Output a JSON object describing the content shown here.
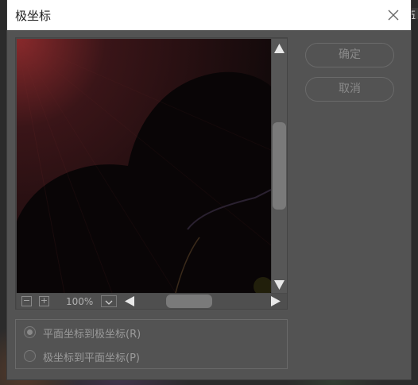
{
  "dialog": {
    "title": "极坐标"
  },
  "buttons": {
    "ok_label": "确定",
    "cancel_label": "取消"
  },
  "preview": {
    "zoom_value": "100%",
    "zoom_out_symbol": "−",
    "zoom_in_symbol": "+"
  },
  "options": {
    "items": [
      {
        "label": "平面坐标到极坐标(R)",
        "selected": true
      },
      {
        "label": "极坐标到平面坐标(P)",
        "selected": false
      }
    ]
  },
  "background": {
    "corner_text": "伍"
  },
  "colors": {
    "dialog_bg": "#535353",
    "titlebar_bg": "#ffffff",
    "preview_bg": "#0e0708",
    "disabled_text": "#8a8a8a"
  }
}
